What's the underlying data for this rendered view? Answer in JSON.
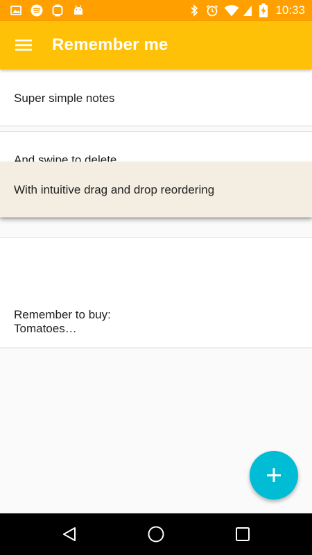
{
  "status_bar": {
    "time": "10:33",
    "left_icons": [
      "image-icon",
      "spotify-icon",
      "watch-icon",
      "android-icon"
    ],
    "right_icons": [
      "bluetooth-icon",
      "alarm-icon",
      "wifi-icon",
      "battery-charging-icon"
    ],
    "background": "#ffa000"
  },
  "app_bar": {
    "title": "Remember me",
    "menu_icon": "hamburger-menu-icon",
    "background": "#ffc107"
  },
  "notes": [
    {
      "text": "Super simple notes"
    },
    {
      "text": "And swipe to delete"
    },
    {
      "text": ""
    },
    {
      "text": "Remember to buy:\nTomatoes…"
    }
  ],
  "dragged_note": {
    "text": "With intuitive drag and drop reordering",
    "background": "#f3eee1"
  },
  "fab": {
    "icon": "plus-icon",
    "color": "#00bcd4"
  },
  "nav_bar": {
    "buttons": [
      "back-icon",
      "home-icon",
      "recents-icon"
    ]
  }
}
